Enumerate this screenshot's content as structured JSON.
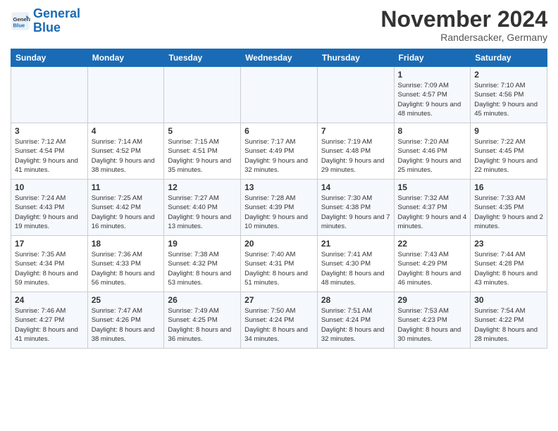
{
  "logo": {
    "line1": "General",
    "line2": "Blue"
  },
  "title": "November 2024",
  "location": "Randersacker, Germany",
  "days_of_week": [
    "Sunday",
    "Monday",
    "Tuesday",
    "Wednesday",
    "Thursday",
    "Friday",
    "Saturday"
  ],
  "weeks": [
    [
      {
        "day": "",
        "info": ""
      },
      {
        "day": "",
        "info": ""
      },
      {
        "day": "",
        "info": ""
      },
      {
        "day": "",
        "info": ""
      },
      {
        "day": "",
        "info": ""
      },
      {
        "day": "1",
        "info": "Sunrise: 7:09 AM\nSunset: 4:57 PM\nDaylight: 9 hours and 48 minutes."
      },
      {
        "day": "2",
        "info": "Sunrise: 7:10 AM\nSunset: 4:56 PM\nDaylight: 9 hours and 45 minutes."
      }
    ],
    [
      {
        "day": "3",
        "info": "Sunrise: 7:12 AM\nSunset: 4:54 PM\nDaylight: 9 hours and 41 minutes."
      },
      {
        "day": "4",
        "info": "Sunrise: 7:14 AM\nSunset: 4:52 PM\nDaylight: 9 hours and 38 minutes."
      },
      {
        "day": "5",
        "info": "Sunrise: 7:15 AM\nSunset: 4:51 PM\nDaylight: 9 hours and 35 minutes."
      },
      {
        "day": "6",
        "info": "Sunrise: 7:17 AM\nSunset: 4:49 PM\nDaylight: 9 hours and 32 minutes."
      },
      {
        "day": "7",
        "info": "Sunrise: 7:19 AM\nSunset: 4:48 PM\nDaylight: 9 hours and 29 minutes."
      },
      {
        "day": "8",
        "info": "Sunrise: 7:20 AM\nSunset: 4:46 PM\nDaylight: 9 hours and 25 minutes."
      },
      {
        "day": "9",
        "info": "Sunrise: 7:22 AM\nSunset: 4:45 PM\nDaylight: 9 hours and 22 minutes."
      }
    ],
    [
      {
        "day": "10",
        "info": "Sunrise: 7:24 AM\nSunset: 4:43 PM\nDaylight: 9 hours and 19 minutes."
      },
      {
        "day": "11",
        "info": "Sunrise: 7:25 AM\nSunset: 4:42 PM\nDaylight: 9 hours and 16 minutes."
      },
      {
        "day": "12",
        "info": "Sunrise: 7:27 AM\nSunset: 4:40 PM\nDaylight: 9 hours and 13 minutes."
      },
      {
        "day": "13",
        "info": "Sunrise: 7:28 AM\nSunset: 4:39 PM\nDaylight: 9 hours and 10 minutes."
      },
      {
        "day": "14",
        "info": "Sunrise: 7:30 AM\nSunset: 4:38 PM\nDaylight: 9 hours and 7 minutes."
      },
      {
        "day": "15",
        "info": "Sunrise: 7:32 AM\nSunset: 4:37 PM\nDaylight: 9 hours and 4 minutes."
      },
      {
        "day": "16",
        "info": "Sunrise: 7:33 AM\nSunset: 4:35 PM\nDaylight: 9 hours and 2 minutes."
      }
    ],
    [
      {
        "day": "17",
        "info": "Sunrise: 7:35 AM\nSunset: 4:34 PM\nDaylight: 8 hours and 59 minutes."
      },
      {
        "day": "18",
        "info": "Sunrise: 7:36 AM\nSunset: 4:33 PM\nDaylight: 8 hours and 56 minutes."
      },
      {
        "day": "19",
        "info": "Sunrise: 7:38 AM\nSunset: 4:32 PM\nDaylight: 8 hours and 53 minutes."
      },
      {
        "day": "20",
        "info": "Sunrise: 7:40 AM\nSunset: 4:31 PM\nDaylight: 8 hours and 51 minutes."
      },
      {
        "day": "21",
        "info": "Sunrise: 7:41 AM\nSunset: 4:30 PM\nDaylight: 8 hours and 48 minutes."
      },
      {
        "day": "22",
        "info": "Sunrise: 7:43 AM\nSunset: 4:29 PM\nDaylight: 8 hours and 46 minutes."
      },
      {
        "day": "23",
        "info": "Sunrise: 7:44 AM\nSunset: 4:28 PM\nDaylight: 8 hours and 43 minutes."
      }
    ],
    [
      {
        "day": "24",
        "info": "Sunrise: 7:46 AM\nSunset: 4:27 PM\nDaylight: 8 hours and 41 minutes."
      },
      {
        "day": "25",
        "info": "Sunrise: 7:47 AM\nSunset: 4:26 PM\nDaylight: 8 hours and 38 minutes."
      },
      {
        "day": "26",
        "info": "Sunrise: 7:49 AM\nSunset: 4:25 PM\nDaylight: 8 hours and 36 minutes."
      },
      {
        "day": "27",
        "info": "Sunrise: 7:50 AM\nSunset: 4:24 PM\nDaylight: 8 hours and 34 minutes."
      },
      {
        "day": "28",
        "info": "Sunrise: 7:51 AM\nSunset: 4:24 PM\nDaylight: 8 hours and 32 minutes."
      },
      {
        "day": "29",
        "info": "Sunrise: 7:53 AM\nSunset: 4:23 PM\nDaylight: 8 hours and 30 minutes."
      },
      {
        "day": "30",
        "info": "Sunrise: 7:54 AM\nSunset: 4:22 PM\nDaylight: 8 hours and 28 minutes."
      }
    ]
  ]
}
